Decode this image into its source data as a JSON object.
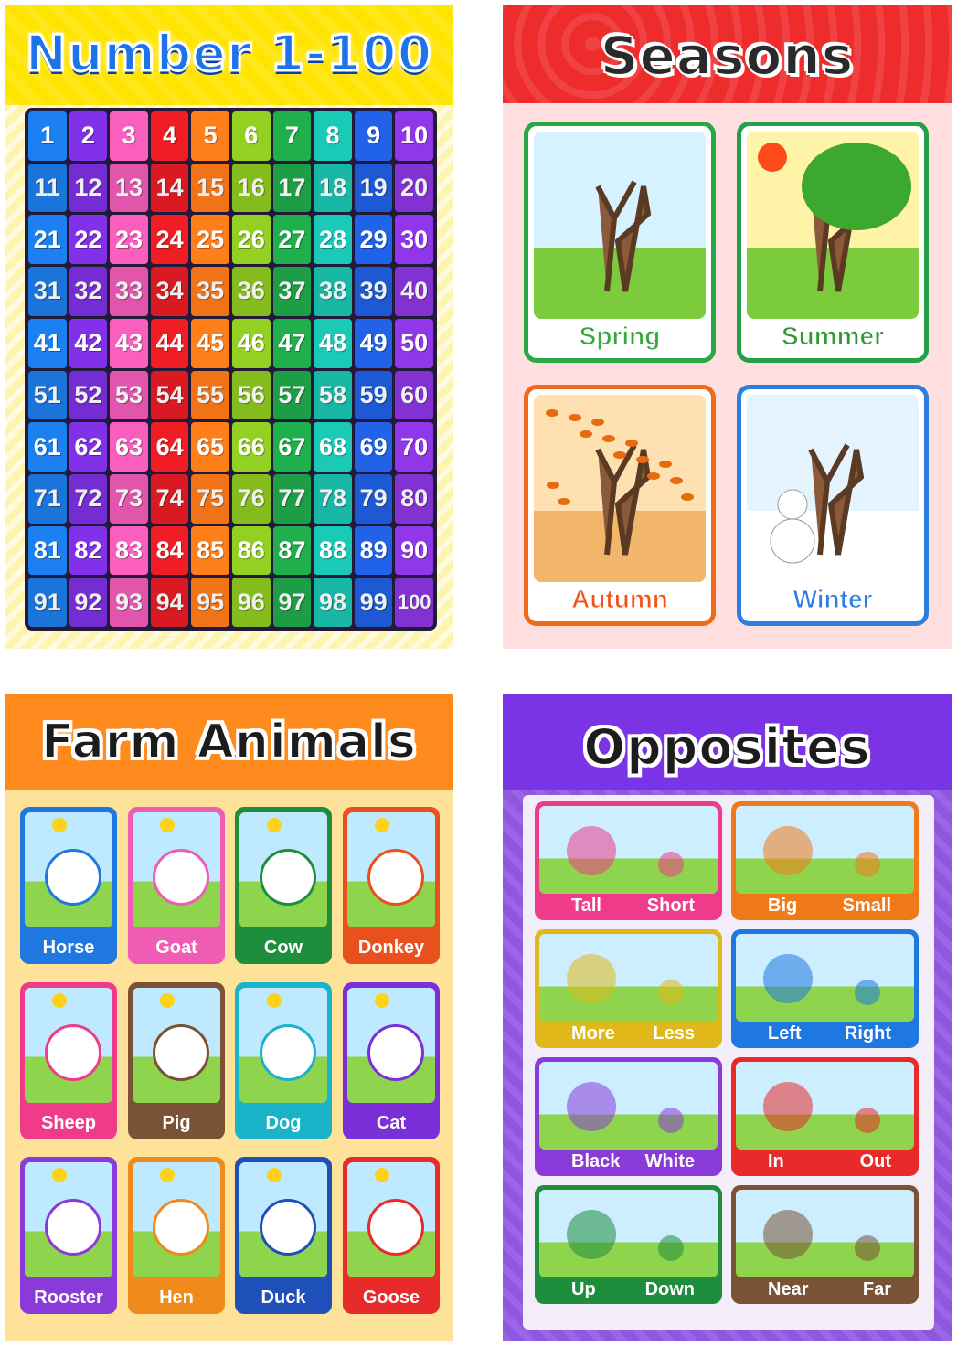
{
  "numbers_poster": {
    "title": "Number 1-100",
    "numbers": [
      1,
      2,
      3,
      4,
      5,
      6,
      7,
      8,
      9,
      10,
      11,
      12,
      13,
      14,
      15,
      16,
      17,
      18,
      19,
      20,
      21,
      22,
      23,
      24,
      25,
      26,
      27,
      28,
      29,
      30,
      31,
      32,
      33,
      34,
      35,
      36,
      37,
      38,
      39,
      40,
      41,
      42,
      43,
      44,
      45,
      46,
      47,
      48,
      49,
      50,
      51,
      52,
      53,
      54,
      55,
      56,
      57,
      58,
      59,
      60,
      61,
      62,
      63,
      64,
      65,
      66,
      67,
      68,
      69,
      70,
      71,
      72,
      73,
      74,
      75,
      76,
      77,
      78,
      79,
      80,
      81,
      82,
      83,
      84,
      85,
      86,
      87,
      88,
      89,
      90,
      91,
      92,
      93,
      94,
      95,
      96,
      97,
      98,
      99,
      100
    ],
    "column_colors": [
      "#1c7be8",
      "#7b2fe0",
      "#f05ab8",
      "#e81c24",
      "#ff7a1a",
      "#8cc820",
      "#1fa84a",
      "#19c2b0",
      "#1f5fe0",
      "#8a35e0"
    ]
  },
  "seasons_poster": {
    "title": "Seasons",
    "cards": [
      {
        "label": "Spring",
        "border": "#2aa845",
        "label_color": "#36a83e",
        "sky": "#d6f1ff"
      },
      {
        "label": "Summer",
        "border": "#24a046",
        "label_color": "#2f9a35",
        "sky": "#fff3a8"
      },
      {
        "label": "Autumn",
        "border": "#f06a1a",
        "label_color": "#f0541a",
        "sky": "#ffe0b0"
      },
      {
        "label": "Winter",
        "border": "#2a7fe0",
        "label_color": "#2a7fe0",
        "sky": "#e4f4ff"
      }
    ]
  },
  "farm_poster": {
    "title": "Farm Animals",
    "animals": [
      {
        "label": "Horse",
        "color": "#1f78e0",
        "icon": "horse-icon"
      },
      {
        "label": "Goat",
        "color": "#ee5cb4",
        "icon": "goat-icon"
      },
      {
        "label": "Cow",
        "color": "#1f8e3c",
        "icon": "cow-icon"
      },
      {
        "label": "Donkey",
        "color": "#e8501e",
        "icon": "donkey-icon"
      },
      {
        "label": "Sheep",
        "color": "#f03a8a",
        "icon": "sheep-icon"
      },
      {
        "label": "Pig",
        "color": "#7a5235",
        "icon": "pig-icon"
      },
      {
        "label": "Dog",
        "color": "#1ab3c8",
        "icon": "dog-icon"
      },
      {
        "label": "Cat",
        "color": "#7b2fd8",
        "icon": "cat-icon"
      },
      {
        "label": "Rooster",
        "color": "#8a3ad8",
        "icon": "rooster-icon"
      },
      {
        "label": "Hen",
        "color": "#f08a1a",
        "icon": "hen-icon"
      },
      {
        "label": "Duck",
        "color": "#1f4fb8",
        "icon": "duck-icon"
      },
      {
        "label": "Goose",
        "color": "#e82a2a",
        "icon": "goose-icon"
      }
    ]
  },
  "opposites_poster": {
    "title": "Opposites",
    "pairs": [
      {
        "a": "Tall",
        "b": "Short",
        "color": "#f03a8a",
        "icon": "giraffe-duck-icon"
      },
      {
        "a": "Big",
        "b": "Small",
        "color": "#f07a1a",
        "icon": "elephant-ladybug-icon"
      },
      {
        "a": "More",
        "b": "Less",
        "color": "#e0b81a",
        "icon": "apples-icon"
      },
      {
        "a": "Left",
        "b": "Right",
        "color": "#1f78e0",
        "icon": "flip-flops-icon"
      },
      {
        "a": "Black",
        "b": "White",
        "color": "#8a3ad8",
        "icon": "cats-icon"
      },
      {
        "a": "In",
        "b": "Out",
        "color": "#e82a2a",
        "icon": "eggs-nest-icon"
      },
      {
        "a": "Up",
        "b": "Down",
        "color": "#1f8e3c",
        "icon": "rooster-stairs-icon"
      },
      {
        "a": "Near",
        "b": "Far",
        "color": "#7a5235",
        "icon": "houses-icon"
      }
    ]
  }
}
